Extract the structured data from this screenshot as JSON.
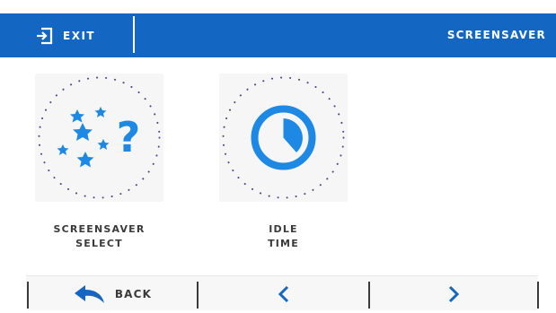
{
  "header": {
    "exit_label": "EXIT",
    "title": "SCREENSAVER"
  },
  "tiles": [
    {
      "line1": "SCREENSAVER",
      "line2": "SELECT",
      "icon": "stars-question-icon"
    },
    {
      "line1": "IDLE",
      "line2": "TIME",
      "icon": "timer-icon"
    }
  ],
  "footer": {
    "back_label": "BACK",
    "prev_icon": "chevron-left-icon",
    "next_icon": "chevron-right-icon"
  },
  "colors": {
    "accent": "#1466c3",
    "icon_blue": "#1e88e5",
    "dots": "#4a4a8a",
    "text": "#3a3a3a"
  }
}
